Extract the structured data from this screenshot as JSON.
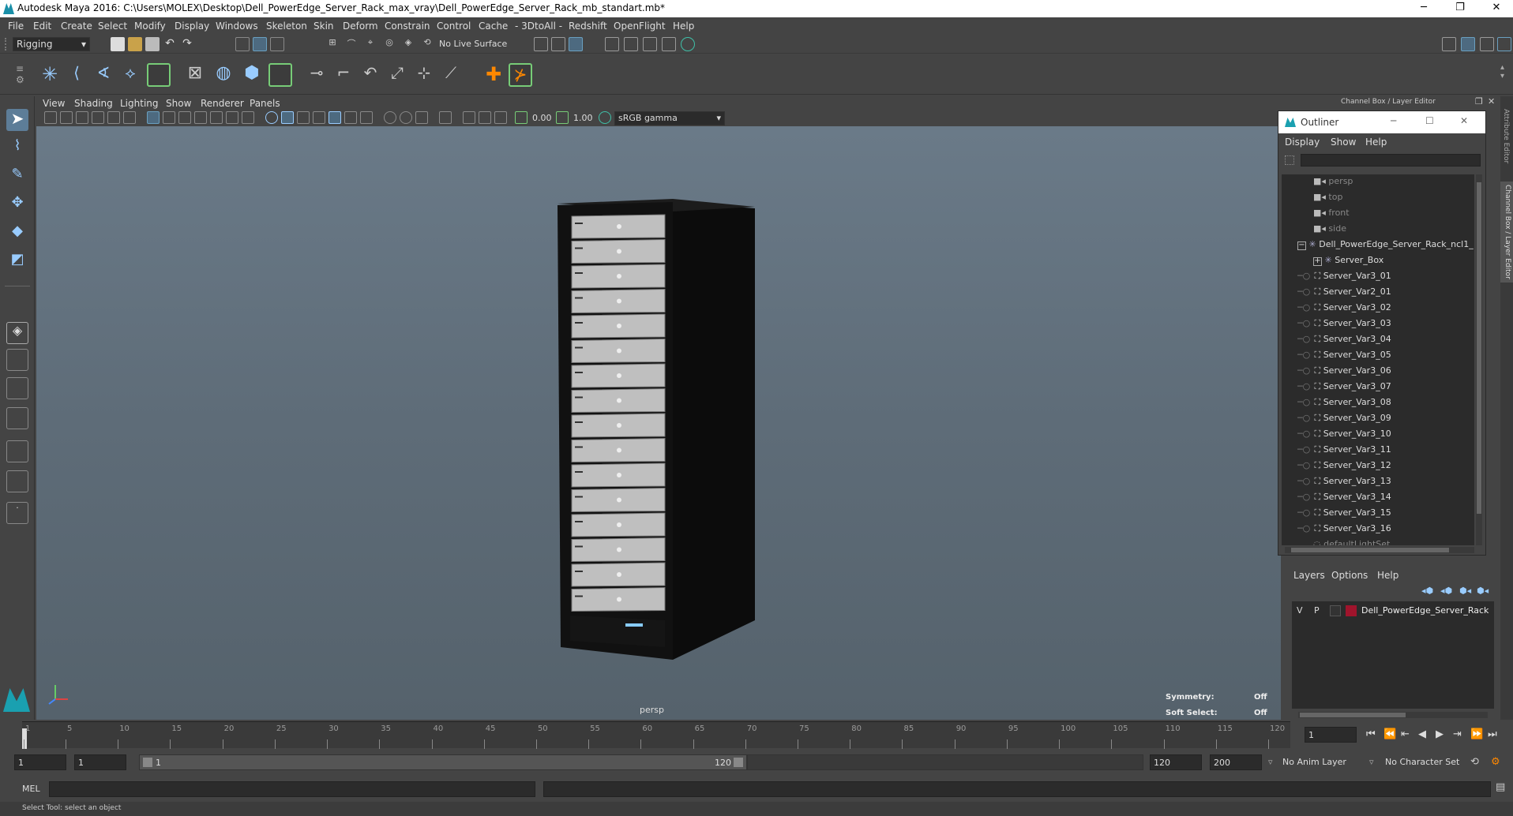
{
  "window": {
    "title": "Autodesk Maya 2016: C:\\Users\\MOLEX\\Desktop\\Dell_PowerEdge_Server_Rack_max_vray\\Dell_PowerEdge_Server_Rack_mb_standart.mb*",
    "minimize": "─",
    "maximize": "❐",
    "close": "✕"
  },
  "menubar": [
    "File",
    "Edit",
    "Create",
    "Select",
    "Modify",
    "Display",
    "Windows",
    "Skeleton",
    "Skin",
    "Deform",
    "Constrain",
    "Control",
    "Cache",
    "- 3DtoAll -",
    "Redshift",
    "OpenFlight",
    "Help"
  ],
  "statusline": {
    "menuset": "Rigging",
    "live_surface": "No Live Surface"
  },
  "viewport": {
    "menus": [
      "View",
      "Shading",
      "Lighting",
      "Show",
      "Renderer",
      "Panels"
    ],
    "near_value": "0.00",
    "far_value": "1.00",
    "colorspace": "sRGB gamma",
    "camera_label": "persp",
    "hud": {
      "symmetry_label": "Symmetry:",
      "symmetry_value": "Off",
      "soft_select_label": "Soft Select:",
      "soft_select_value": "Off"
    }
  },
  "right_panel": {
    "title": "Channel Box / Layer Editor",
    "side_tabs": [
      "Attribute Editor",
      "Channel Box / Layer Editor"
    ]
  },
  "outliner": {
    "title": "Outliner",
    "menus": [
      "Display",
      "Show",
      "Help"
    ],
    "cameras": [
      "persp",
      "top",
      "front",
      "side"
    ],
    "root": "Dell_PowerEdge_Server_Rack_ncl1_",
    "group": "Server_Box",
    "items": [
      "Server_Var3_01",
      "Server_Var2_01",
      "Server_Var3_02",
      "Server_Var3_03",
      "Server_Var3_04",
      "Server_Var3_05",
      "Server_Var3_06",
      "Server_Var3_07",
      "Server_Var3_08",
      "Server_Var3_09",
      "Server_Var3_10",
      "Server_Var3_11",
      "Server_Var3_12",
      "Server_Var3_13",
      "Server_Var3_14",
      "Server_Var3_15",
      "Server_Var3_16"
    ],
    "trailing": "defaultLightSet"
  },
  "layer_editor": {
    "menus": [
      "Layers",
      "Options",
      "Help"
    ],
    "layer": {
      "v": "V",
      "p": "P",
      "name": "Dell_PowerEdge_Server_Rack",
      "color": "#a0142c"
    }
  },
  "timeline": {
    "ticks": [
      "1",
      "5",
      "10",
      "15",
      "20",
      "25",
      "30",
      "35",
      "40",
      "45",
      "50",
      "55",
      "60",
      "65",
      "70",
      "75",
      "80",
      "85",
      "90",
      "95",
      "100",
      "105",
      "110",
      "115",
      "120"
    ],
    "current_frame": "1"
  },
  "range": {
    "start": "1",
    "playback_start": "1",
    "slider_start": "1",
    "slider_end": "120",
    "playback_end": "120",
    "end": "200",
    "anim_layer": "No Anim Layer",
    "character_set": "No Character Set"
  },
  "command_line": {
    "label": "MEL"
  },
  "help_line": "Select Tool: select an object"
}
